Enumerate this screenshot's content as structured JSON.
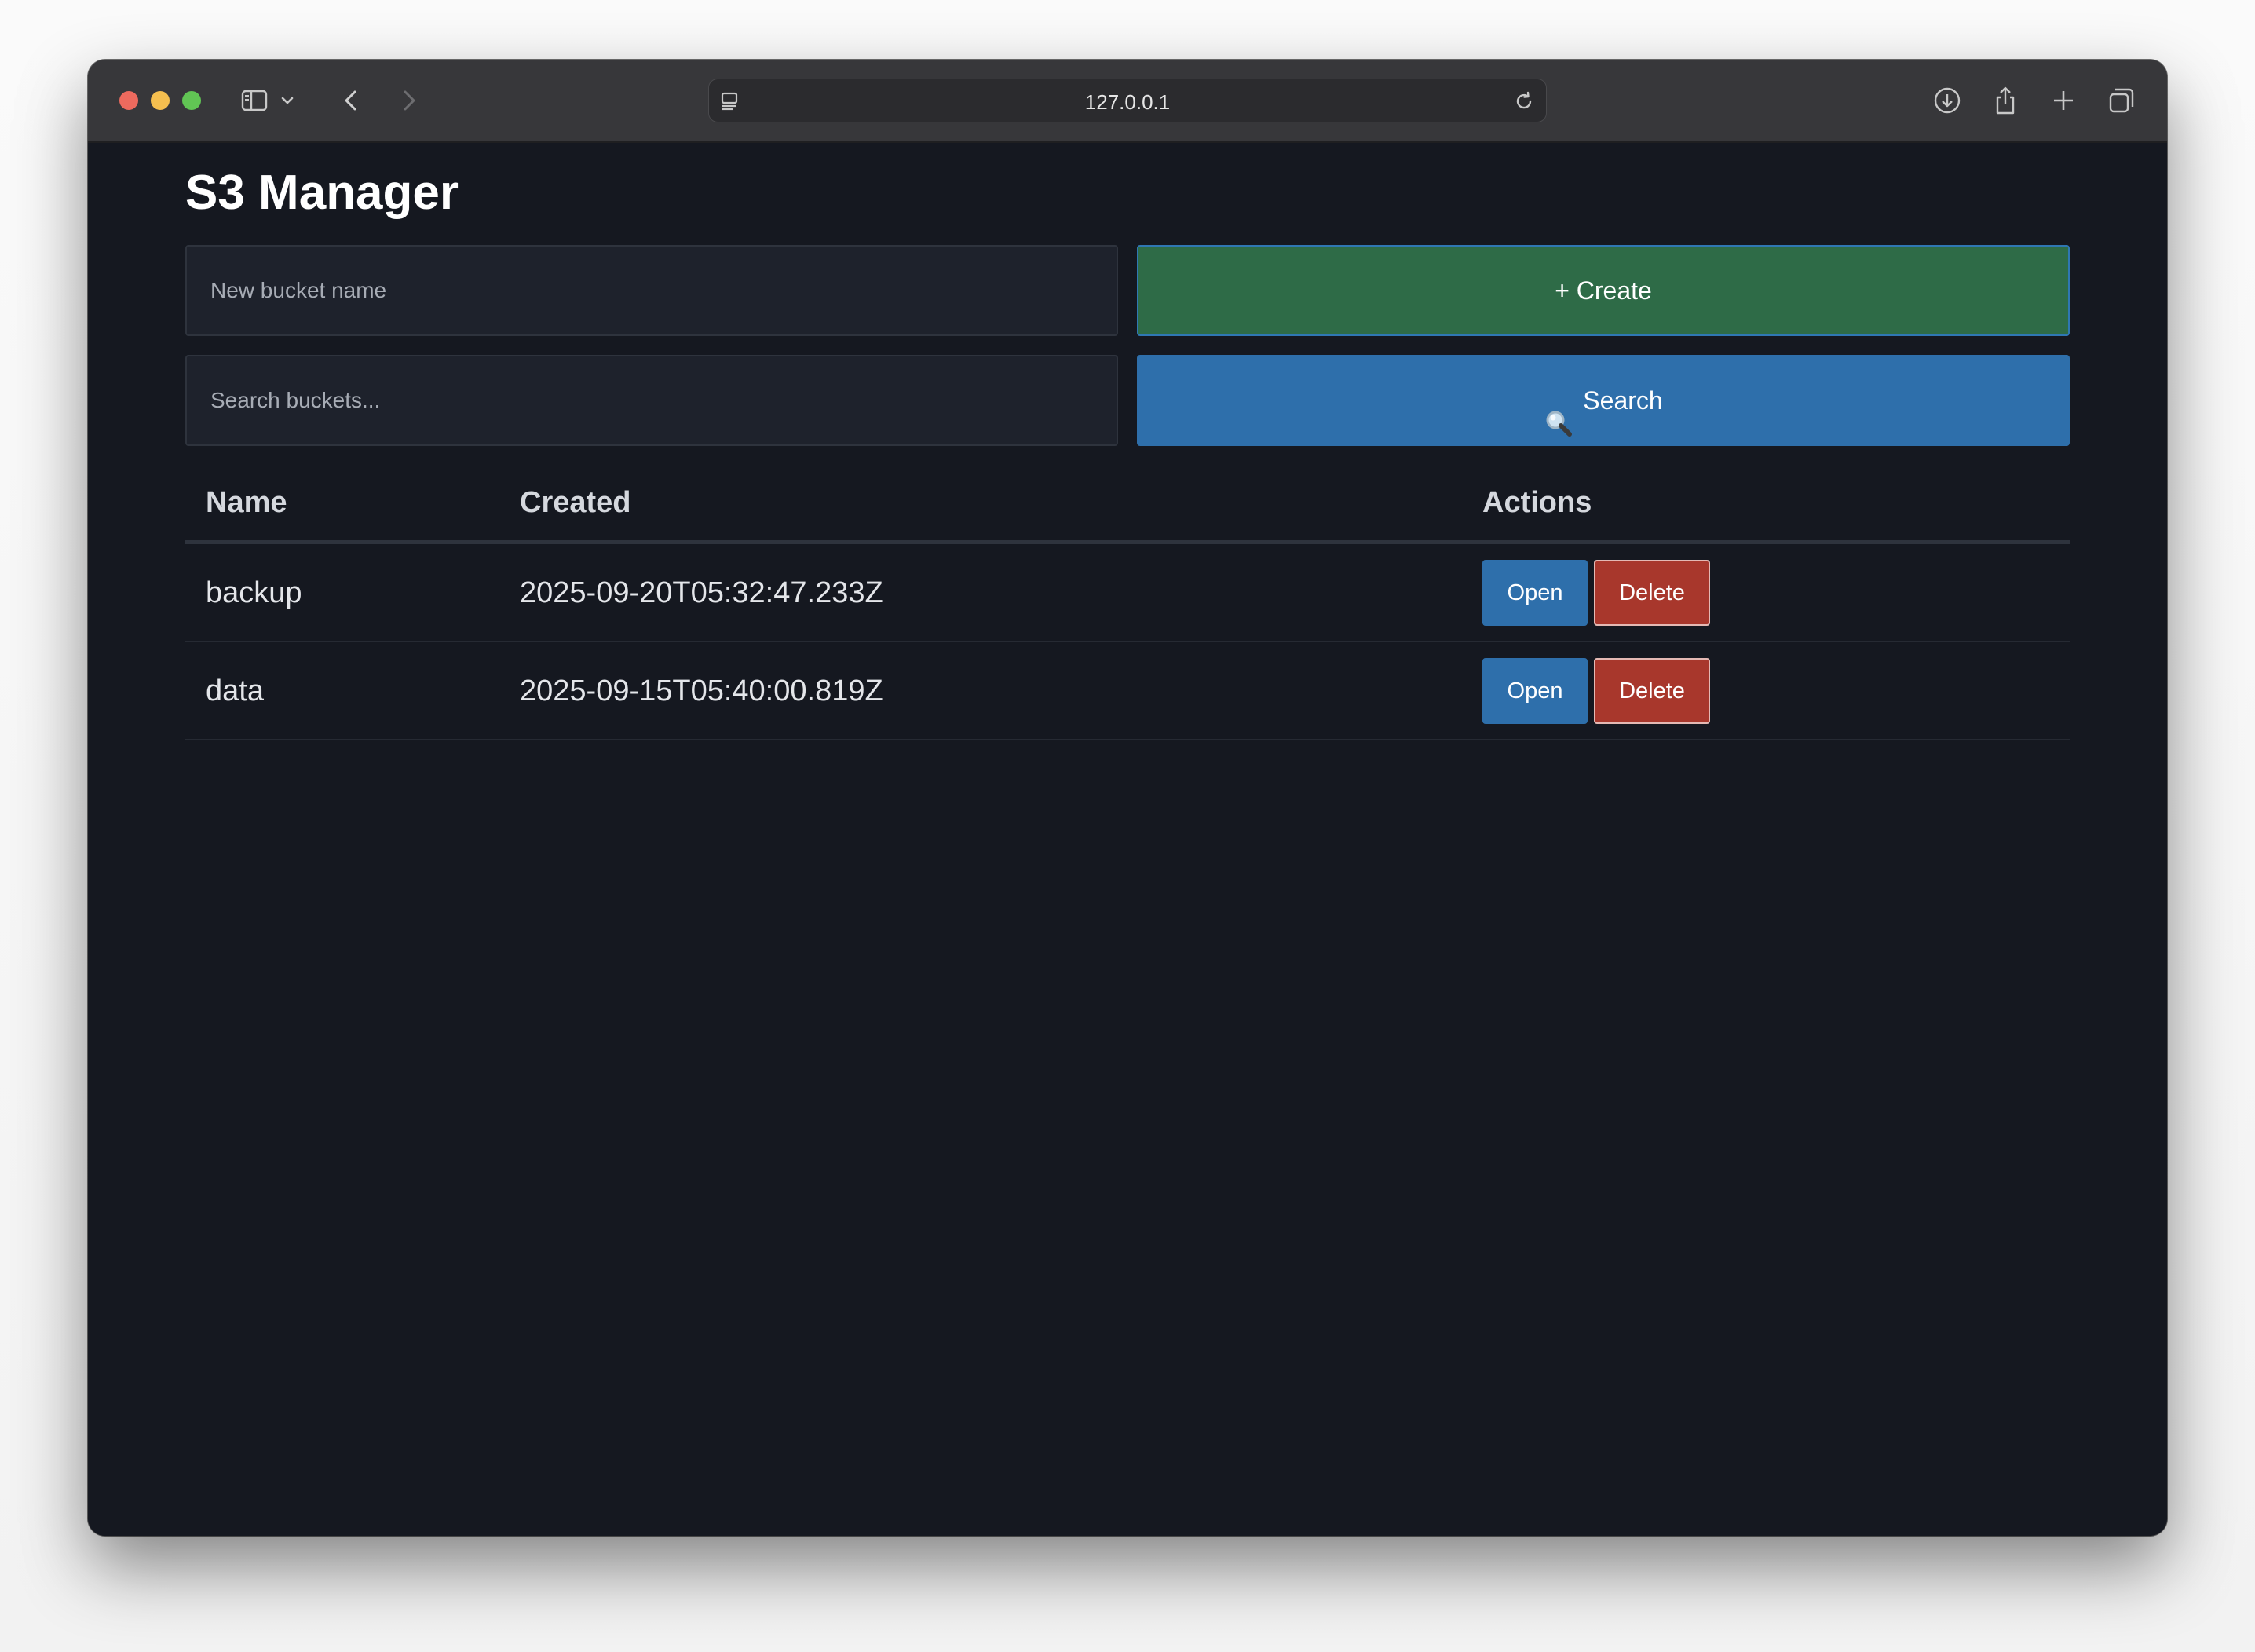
{
  "browser": {
    "url": "127.0.0.1"
  },
  "page": {
    "title": "S3 Manager"
  },
  "create": {
    "placeholder": "New bucket name",
    "value": "",
    "button_label": "+ Create"
  },
  "search": {
    "placeholder": "Search buckets...",
    "value": "",
    "button_label": "Search",
    "button_icon": "magnifier-icon"
  },
  "table": {
    "headers": {
      "name": "Name",
      "created": "Created",
      "actions": "Actions"
    },
    "rows": [
      {
        "name": "backup",
        "created": "2025-09-20T05:32:47.233Z",
        "open_label": "Open",
        "delete_label": "Delete"
      },
      {
        "name": "data",
        "created": "2025-09-15T05:40:00.819Z",
        "open_label": "Open",
        "delete_label": "Delete"
      }
    ]
  },
  "colors": {
    "background": "#151820",
    "create_button": "#2e6b47",
    "primary_button": "#2e6fab",
    "danger_button": "#a8372c"
  }
}
